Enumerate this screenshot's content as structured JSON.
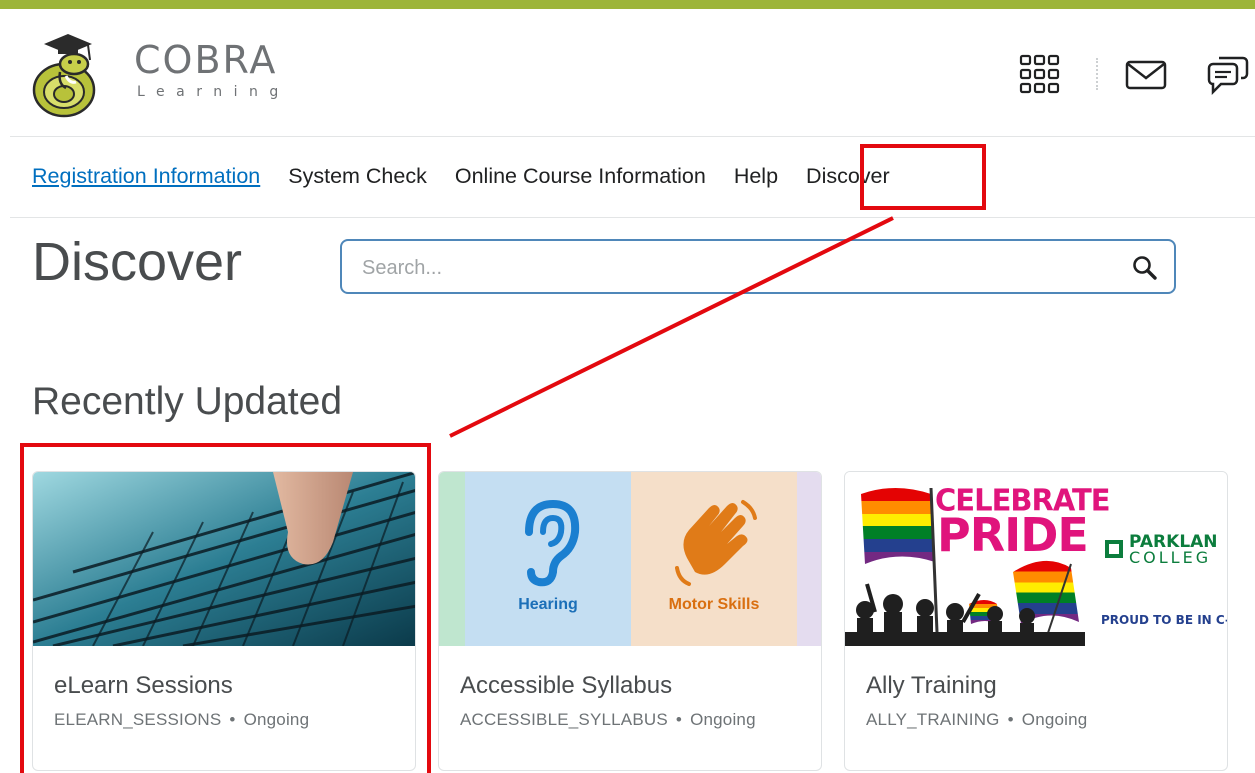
{
  "brand": {
    "name": "COBRA",
    "sub": "Learning"
  },
  "header_icons": [
    "app-grid-icon",
    "mail-icon",
    "chat-icon"
  ],
  "nav": [
    {
      "label": "Registration Information",
      "active_link": true
    },
    {
      "label": "System Check"
    },
    {
      "label": "Online Course Information"
    },
    {
      "label": "Help"
    },
    {
      "label": "Discover"
    }
  ],
  "discover": {
    "title": "Discover",
    "search_placeholder": "Search...",
    "section": "Recently Updated",
    "cards": [
      {
        "title": "eLearn Sessions",
        "code": "ELEARN_SESSIONS",
        "status": "Ongoing"
      },
      {
        "title": "Accessible Syllabus",
        "code": "ACCESSIBLE_SYLLABUS",
        "status": "Ongoing",
        "image_labels": {
          "hearing": "Hearing",
          "motor": "Motor Skills"
        }
      },
      {
        "title": "Ally Training",
        "code": "ALLY_TRAINING",
        "status": "Ongoing",
        "image_labels": {
          "celebrate": "CELEBRATE",
          "pride": "PRIDE",
          "college_1": "PARKLAN",
          "college_2": "COLLEG",
          "proud": "PROUD TO BE IN C-U"
        }
      }
    ]
  },
  "colors": {
    "accent_bar": "#9db53a",
    "link": "#006fbf",
    "annotation": "#e3090f",
    "search_border": "#4f87b9"
  }
}
